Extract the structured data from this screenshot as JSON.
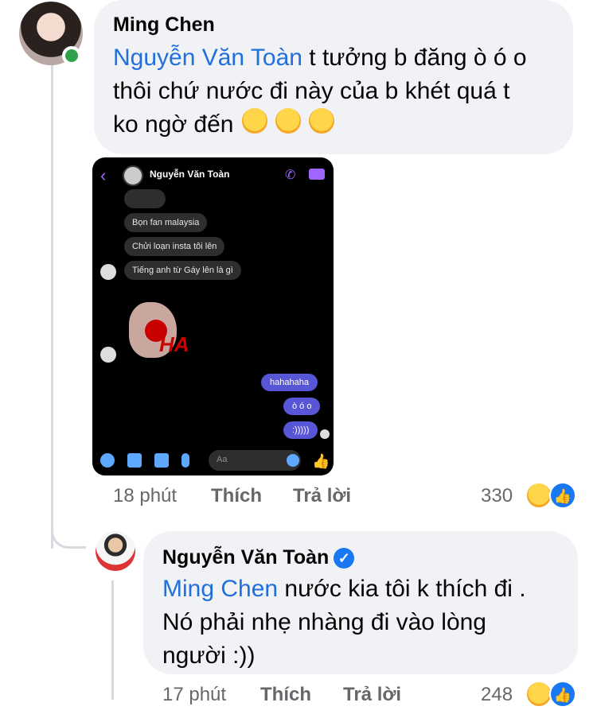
{
  "comment1": {
    "author": "Ming Chen",
    "mention": "Nguyễn Văn Toàn",
    "line1_rest": " t tưởng b đăng ò ó o",
    "line2": "thôi chứ nước đi này của b khét quá t",
    "line3": "ko ngờ đến",
    "emojis": [
      "🤣",
      "🤣",
      "🤣"
    ],
    "time": "18 phút",
    "like": "Thích",
    "reply": "Trả lời",
    "reaction_count": "330"
  },
  "screenshot": {
    "contact_name": "Nguyễn Văn Toàn",
    "messages_in": [
      "Bọn fan malaysia",
      "Chửi loạn insta tôi lên",
      "Tiếng anh từ Gáy lên là gì"
    ],
    "sticker_text": "HA",
    "messages_out": [
      "hahahaha",
      "ò ó o",
      ":)))))"
    ],
    "compose_placeholder": "Aa",
    "icons": {
      "back": "chevron-left-icon",
      "call": "phone-icon",
      "video": "video-icon",
      "like": "thumbs-up-icon"
    },
    "accent": "#a066ff"
  },
  "comment2": {
    "author": "Nguyễn Văn Toàn",
    "mention": "Ming Chen",
    "line1_rest": "  nước kia tôi k thích đi .",
    "line2": "Nó phải nhẹ nhàng đi vào lòng",
    "line3": "người :))",
    "time": "17 phút",
    "like": "Thích",
    "reply": "Trả lời",
    "reaction_count": "248"
  },
  "colors": {
    "mention": "#216fdb",
    "bubble": "#f0f2f5",
    "meta": "#65676b",
    "like_blue": "#1877f2",
    "online": "#31a24c"
  }
}
